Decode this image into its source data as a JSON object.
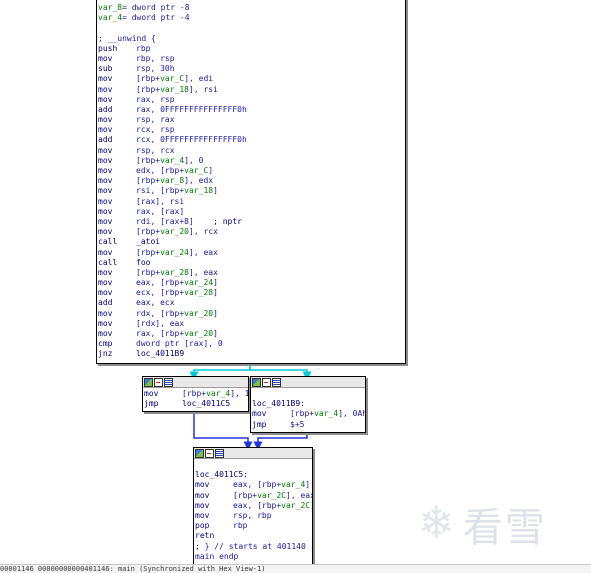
{
  "main_block": {
    "lines": [
      {
        "a": "var_8= dword ptr -8"
      },
      {
        "a": "var_4= dword ptr -4"
      },
      {
        "a": ""
      },
      {
        "a": "; __unwind {"
      },
      {
        "m": "push",
        "o": "rbp"
      },
      {
        "m": "mov",
        "o": "rbp, rsp"
      },
      {
        "m": "sub",
        "o": "rsp, 30h"
      },
      {
        "m": "mov",
        "o": "[rbp+var_C], edi"
      },
      {
        "m": "mov",
        "o": "[rbp+var_18], rsi"
      },
      {
        "m": "mov",
        "o": "rax, rsp"
      },
      {
        "m": "add",
        "o": "rax, 0FFFFFFFFFFFFFFF0h"
      },
      {
        "m": "mov",
        "o": "rsp, rax"
      },
      {
        "m": "mov",
        "o": "rcx, rsp"
      },
      {
        "m": "add",
        "o": "rcx, 0FFFFFFFFFFFFFFF0h"
      },
      {
        "m": "mov",
        "o": "rsp, rcx"
      },
      {
        "m": "mov",
        "o": "[rbp+var_4], 0"
      },
      {
        "m": "mov",
        "o": "edx, [rbp+var_C]"
      },
      {
        "m": "mov",
        "o": "[rbp+var_8], edx"
      },
      {
        "m": "mov",
        "o": "rsi, [rbp+var_18]"
      },
      {
        "m": "mov",
        "o": "[rax], rsi"
      },
      {
        "m": "mov",
        "o": "rax, [rax]"
      },
      {
        "m": "mov",
        "o": "rdi, [rax+8]    ; nptr"
      },
      {
        "m": "mov",
        "o": "[rbp+var_20], rcx"
      },
      {
        "m": "call",
        "o": "_atoi"
      },
      {
        "m": "mov",
        "o": "[rbp+var_24], eax"
      },
      {
        "m": "call",
        "o": "foo"
      },
      {
        "m": "mov",
        "o": "[rbp+var_28], eax"
      },
      {
        "m": "mov",
        "o": "eax, [rbp+var_24]"
      },
      {
        "m": "mov",
        "o": "ecx, [rbp+var_28]"
      },
      {
        "m": "add",
        "o": "eax, ecx"
      },
      {
        "m": "mov",
        "o": "rdx, [rbp+var_20]"
      },
      {
        "m": "mov",
        "o": "[rdx], eax"
      },
      {
        "m": "mov",
        "o": "rax, [rbp+var_20]"
      },
      {
        "m": "cmp",
        "o": "dword ptr [rax], 0"
      },
      {
        "m": "jnz",
        "o": "loc_4011B9"
      }
    ]
  },
  "left_block": {
    "lines": [
      {
        "m": "mov",
        "o": "[rbp+var_4], 1"
      },
      {
        "m": "jmp",
        "o": "loc_4011C5"
      }
    ]
  },
  "right_block": {
    "lines": [
      {
        "a": ""
      },
      {
        "a": "loc_4011B9:"
      },
      {
        "m": "mov",
        "o": "[rbp+var_4], 0Ah"
      },
      {
        "m": "jmp",
        "o": "$+5"
      }
    ]
  },
  "bottom_block": {
    "lines": [
      {
        "a": ""
      },
      {
        "a": "loc_4011C5:"
      },
      {
        "m": "mov",
        "o": "eax, [rbp+var_4]"
      },
      {
        "m": "mov",
        "o": "[rbp+var_2C], eax"
      },
      {
        "m": "mov",
        "o": "eax, [rbp+var_2C]"
      },
      {
        "m": "mov",
        "o": "rsp, rbp"
      },
      {
        "m": "pop",
        "o": "rbp"
      },
      {
        "m": "retn",
        "o": ""
      },
      {
        "a": "; } // starts at 401140"
      },
      {
        "a": "main endp"
      }
    ]
  },
  "watermark": {
    "text": "看雪",
    "icon": "snowflake-icon"
  },
  "statusbar": {
    "text": "00001146 00000000000401146: main (Synchronized with Hex View-1)"
  },
  "colors": {
    "edge_true": "#00c8d8",
    "edge_false": "#2233dd",
    "edge_uncond": "#3050d0",
    "mnemonic": "#000080",
    "variable": "#008000"
  }
}
